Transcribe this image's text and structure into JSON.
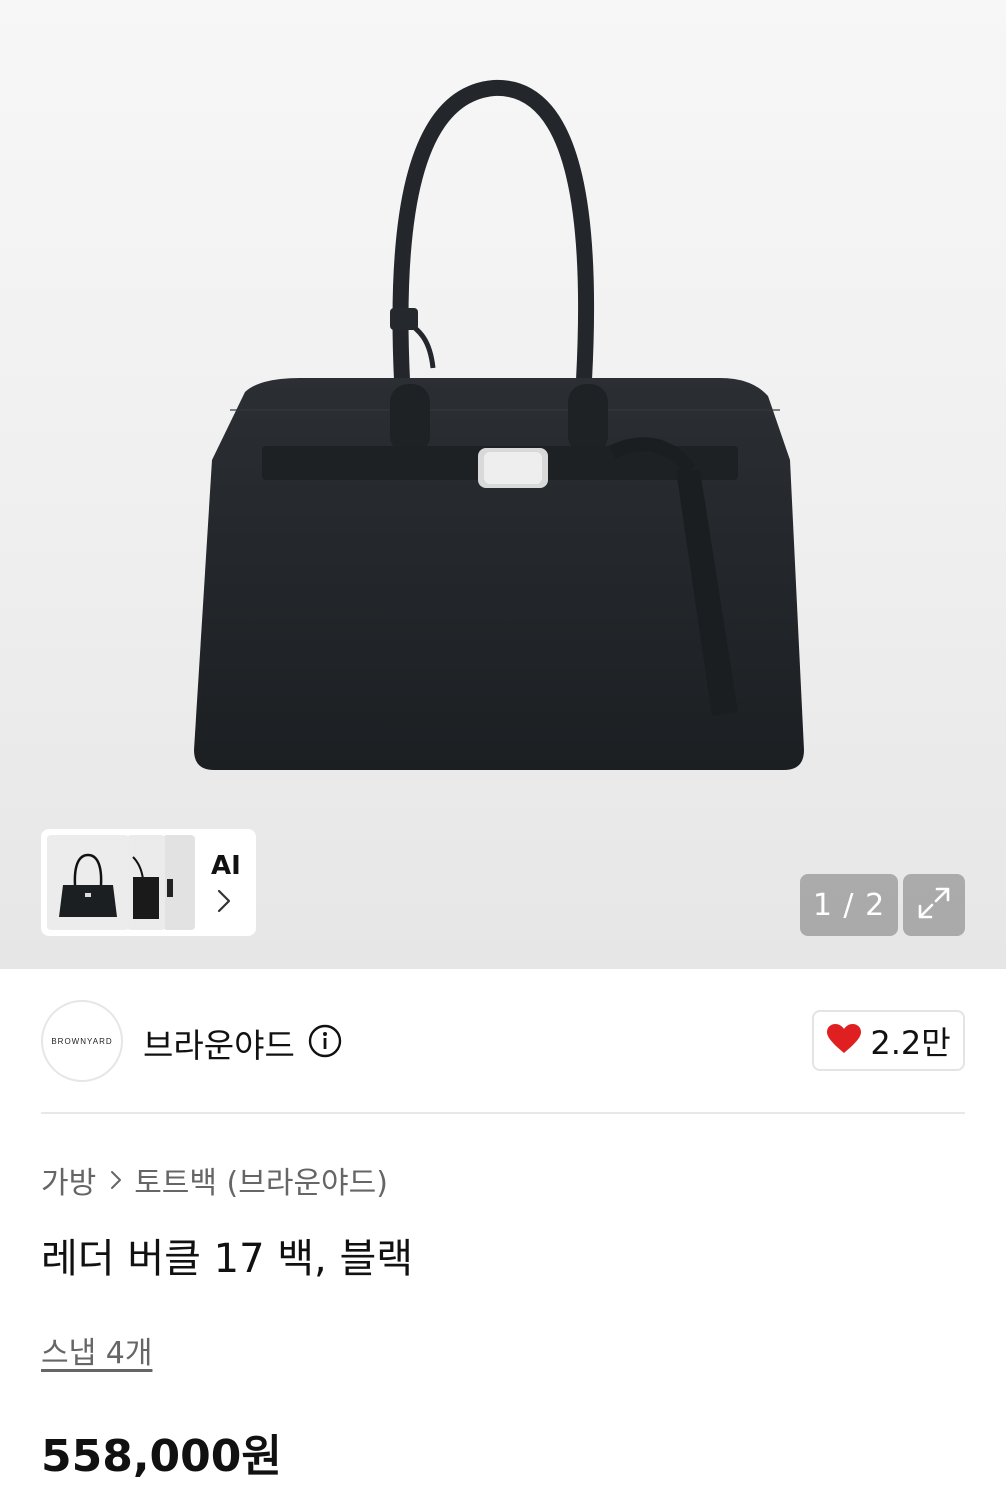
{
  "gallery": {
    "image_alt": "레더 버클 17 백, 블랙",
    "page_current": 1,
    "page_total": 2,
    "page_indicator": "1 / 2",
    "ai_label": "AI"
  },
  "brand": {
    "logo_text": "BROWNYARD",
    "name": "브라운야드"
  },
  "like": {
    "count": "2.2만",
    "color": "#e02020"
  },
  "breadcrumb": {
    "category": "가방",
    "subcategory": "토트백 (브라운야드)"
  },
  "product": {
    "title": "레더 버클 17 백, 블랙",
    "snap": "스냅 4개",
    "price": "558,000원"
  },
  "icons": [
    "info-icon",
    "heart-icon",
    "expand-icon",
    "chevron-right-icon"
  ]
}
